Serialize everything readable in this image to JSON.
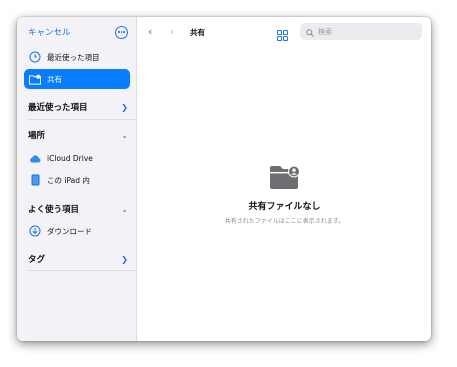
{
  "sidebar": {
    "cancel_label": "キャンセル",
    "items": [
      {
        "label": "最近使った項目",
        "icon": "clock-icon"
      },
      {
        "label": "共有",
        "icon": "shared-folder-icon",
        "selected": true
      }
    ],
    "sections": [
      {
        "label": "最近使った項目"
      },
      {
        "label": "場所"
      },
      {
        "label": "よく使う項目"
      },
      {
        "label": "タグ"
      }
    ],
    "locations": [
      {
        "label": "iCloud Drive",
        "icon": "cloud-icon"
      },
      {
        "label": "この iPad 内",
        "icon": "ipad-icon"
      }
    ],
    "favorites": [
      {
        "label": "ダウンロード",
        "icon": "download-icon"
      }
    ]
  },
  "main": {
    "title": "共有",
    "search_placeholder": "検索",
    "empty_title": "共有ファイルなし",
    "empty_subtitle": "共有されたファイルはここに表示されます。"
  },
  "colors": {
    "accent": "#1a73e8",
    "selected": "#0a7cff",
    "sidebar_bg": "#f2f2f7"
  }
}
